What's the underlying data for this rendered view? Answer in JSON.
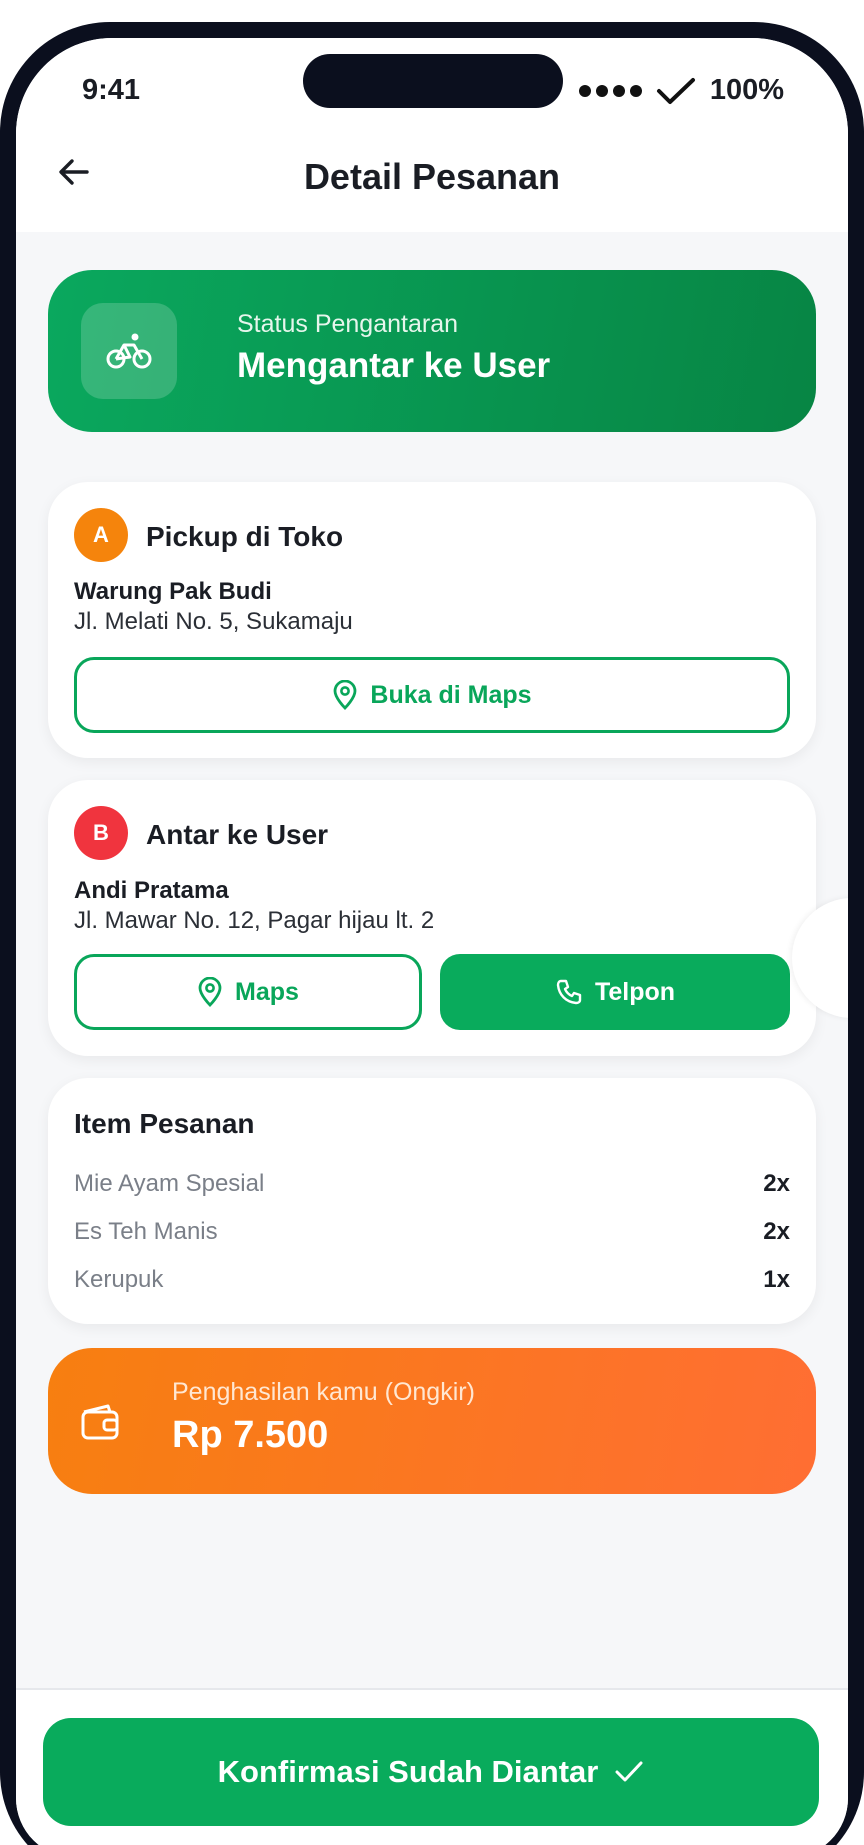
{
  "status_bar": {
    "time": "9:41",
    "battery": "100%"
  },
  "header": {
    "title": "Detail Pesanan",
    "back_icon": "arrow-left-icon"
  },
  "delivery_status": {
    "label": "Status Pengantaran",
    "value": "Mengantar ke User",
    "icon": "bicycle-icon"
  },
  "pickup": {
    "badge": "A",
    "title": "Pickup di Toko",
    "name": "Warung Pak Budi",
    "address": "Jl. Melati No. 5, Sukamaju",
    "maps_button": "Buka di Maps"
  },
  "dropoff": {
    "badge": "B",
    "title": "Antar ke User",
    "name": "Andi Pratama",
    "address": "Jl. Mawar No. 12, Pagar hijau lt. 2",
    "maps_button": "Maps",
    "call_button": "Telpon"
  },
  "order_items": {
    "title": "Item Pesanan",
    "items": [
      {
        "name": "Mie Ayam Spesial",
        "qty": "2x"
      },
      {
        "name": "Es Teh Manis",
        "qty": "2x"
      },
      {
        "name": "Kerupuk",
        "qty": "1x"
      }
    ]
  },
  "earnings": {
    "label": "Penghasilan kamu (Ongkir)",
    "value": "Rp 7.500",
    "icon": "wallet-icon"
  },
  "confirm_button": {
    "label": "Konfirmasi Sudah Diantar"
  },
  "colors": {
    "primary_green": "#09AB5C",
    "orange": "#F77F10",
    "red_badge": "#F0343E"
  }
}
